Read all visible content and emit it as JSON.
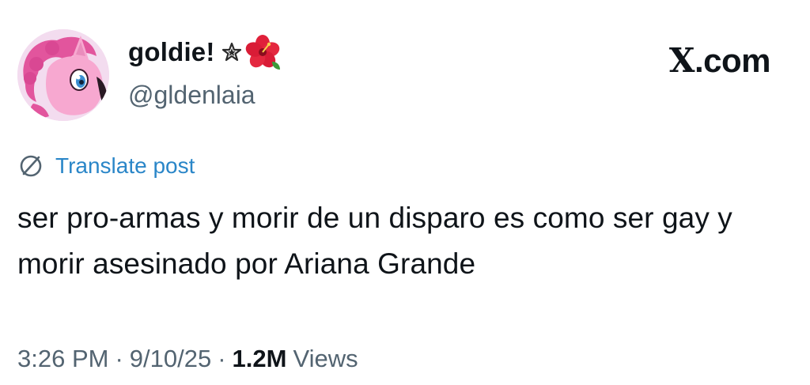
{
  "author": {
    "display_name": "goldie!",
    "handle": "@gldenlaia",
    "avatar_icon": "pink-pony-avatar",
    "badges": [
      "star-icon",
      "hibiscus-icon"
    ]
  },
  "brand": {
    "text": ".com",
    "mark": "X"
  },
  "translate": {
    "label": "Translate post",
    "icon": "globe-icon",
    "color": "#1d9bf0"
  },
  "post": {
    "text": "ser pro-armas y morir de un disparo es como ser gay y morir asesinado por Ariana Grande"
  },
  "meta": {
    "time": "3:26 PM",
    "separator": "·",
    "date": "9/10/25",
    "views_count": "1.2M",
    "views_label": "Views"
  },
  "colors": {
    "text": "#0f1419",
    "secondary": "#536471",
    "link": "#1d9bf0",
    "background": "#ffffff"
  }
}
